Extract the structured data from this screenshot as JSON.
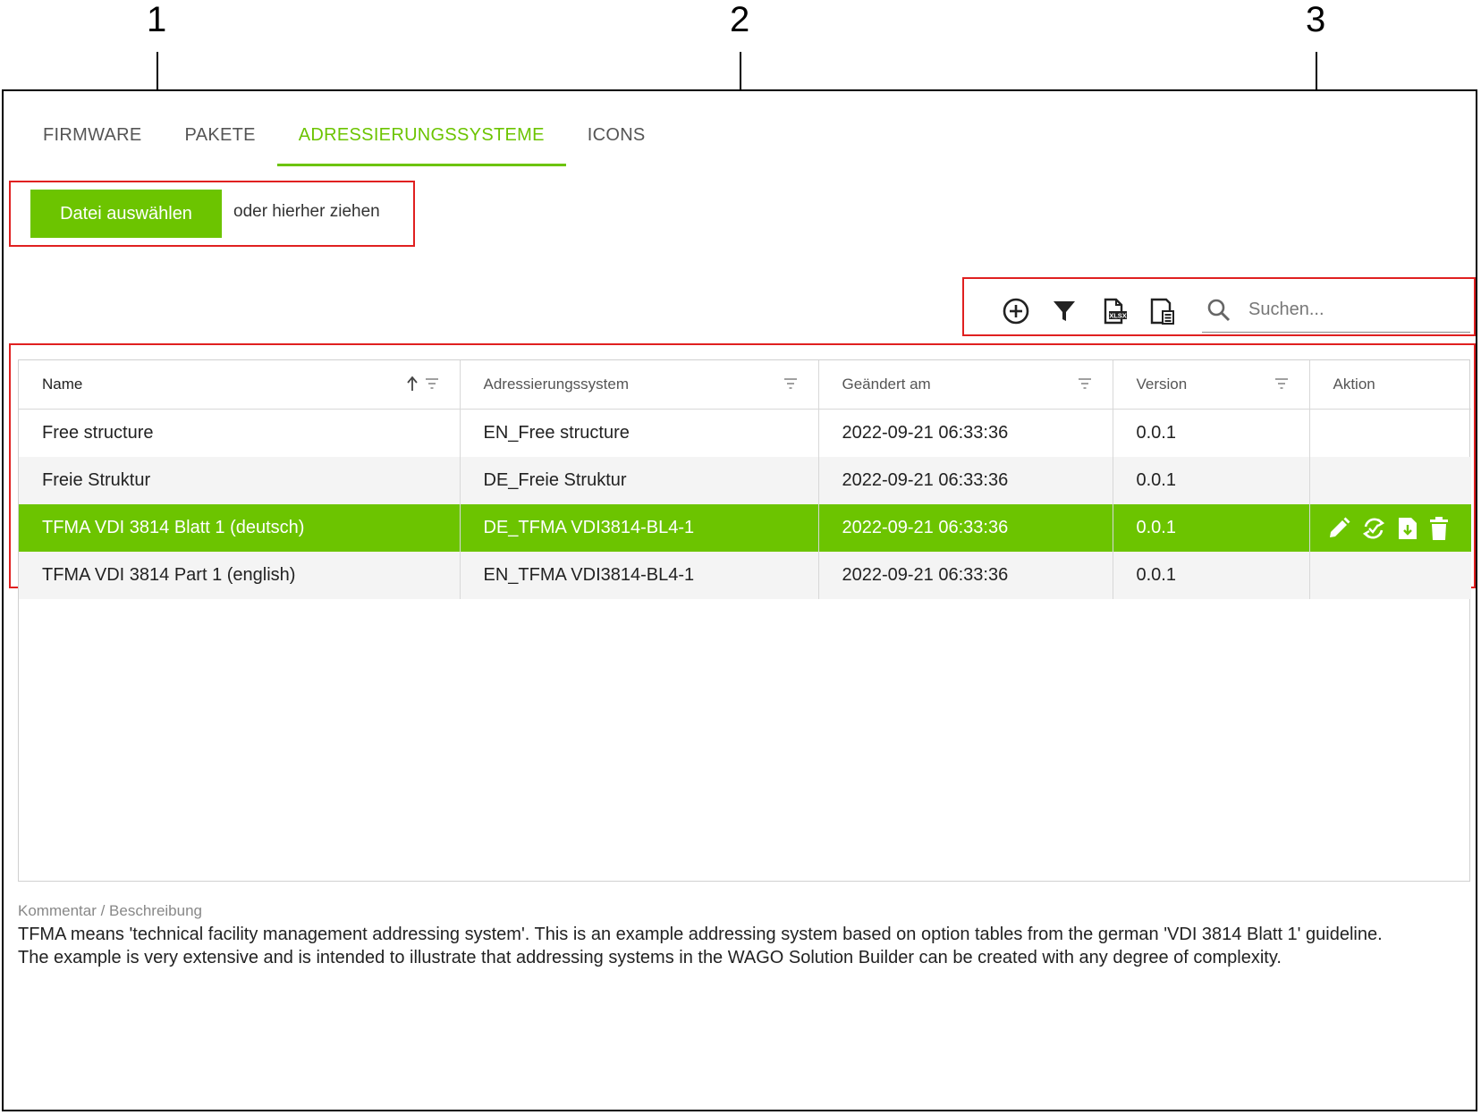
{
  "callouts": [
    "1",
    "2",
    "3"
  ],
  "tabs": [
    {
      "label": "FIRMWARE",
      "active": false
    },
    {
      "label": "PAKETE",
      "active": false
    },
    {
      "label": "ADRESSIERUNGSSYSTEME",
      "active": true
    },
    {
      "label": "ICONS",
      "active": false
    }
  ],
  "upload": {
    "button_label": "Datei auswählen",
    "hint": "oder hierher ziehen"
  },
  "toolbar": {
    "icons": [
      "add-circle-icon",
      "filter-icon",
      "xlsx-export-icon",
      "document-list-icon"
    ],
    "search_placeholder": "Suchen..."
  },
  "table": {
    "columns": [
      "Name",
      "Adressierungssystem",
      "Geändert am",
      "Version",
      "Aktion"
    ],
    "rows": [
      {
        "name": "Free structure",
        "system": "EN_Free structure",
        "changed": "2022-09-21 06:33:36",
        "version": "0.0.1"
      },
      {
        "name": "Freie Struktur",
        "system": "DE_Freie Struktur",
        "changed": "2022-09-21 06:33:36",
        "version": "0.0.1"
      },
      {
        "name": "TFMA VDI 3814 Blatt 1 (deutsch)",
        "system": "DE_TFMA VDI3814-BL4-1",
        "changed": "2022-09-21 06:33:36",
        "version": "0.0.1"
      },
      {
        "name": "TFMA VDI 3814 Part 1 (english)",
        "system": "EN_TFMA VDI3814-BL4-1",
        "changed": "2022-09-21 06:33:36",
        "version": "0.0.1"
      }
    ],
    "selected_row": 2,
    "action_icons": [
      "edit-icon",
      "sync-icon",
      "download-icon",
      "delete-icon"
    ]
  },
  "comment": {
    "label": "Kommentar / Beschreibung",
    "text": "TFMA means 'technical facility management addressing system'. This is an example addressing system based on option tables from the german 'VDI 3814 Blatt 1' guideline.\nThe example is very extensive and is intended to illustrate that addressing systems in the WAGO Solution Builder can be created with any degree of complexity."
  },
  "colors": {
    "accent": "#6cc400",
    "highlight": "#e02020"
  }
}
